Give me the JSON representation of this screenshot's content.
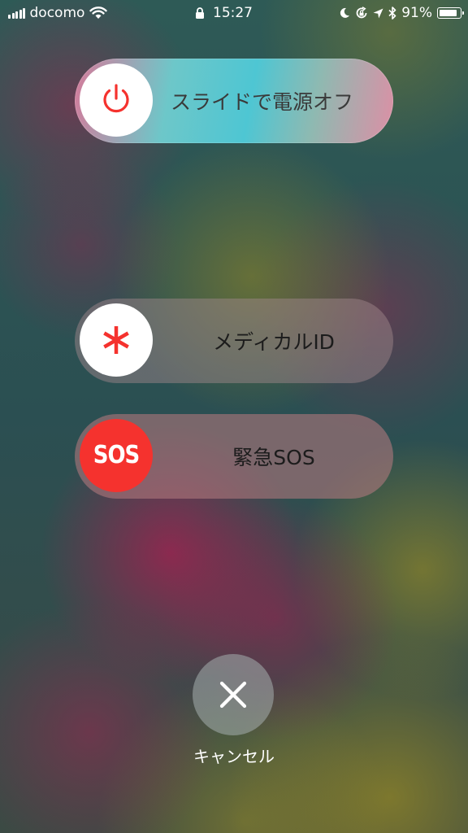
{
  "status_bar": {
    "carrier": "docomo",
    "time": "15:27",
    "battery_percent": "91%",
    "battery_level": 0.91,
    "icons": [
      "signal-icon",
      "wifi-icon",
      "lock-icon",
      "moon-icon",
      "rotation-lock-icon",
      "location-icon",
      "bluetooth-icon",
      "battery-icon"
    ]
  },
  "sliders": {
    "power": {
      "label": "スライドで電源オフ",
      "icon": "power-icon",
      "accent": "#f5322e"
    },
    "medical": {
      "label": "メディカルID",
      "icon": "asterisk-icon",
      "accent": "#f5322e"
    },
    "sos": {
      "label": "緊急SOS",
      "knob_text": "SOS",
      "accent": "#f5322e"
    }
  },
  "cancel": {
    "label": "キャンセル",
    "icon": "close-icon"
  }
}
